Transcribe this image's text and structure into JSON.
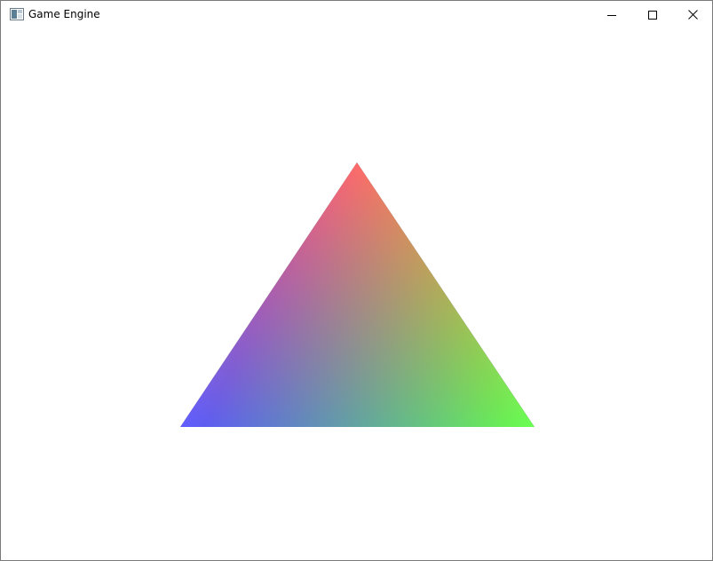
{
  "window": {
    "title": "Game Engine",
    "buttons": {
      "minimize_icon": "minimize-icon",
      "maximize_icon": "maximize-icon",
      "close_icon": "close-icon"
    }
  },
  "scene": {
    "shape": "triangle",
    "vertex_colors": {
      "top": "#ff1a1a",
      "bottom_left": "#1a1aff",
      "bottom_right": "#2aff0a"
    },
    "background": "#ffffff"
  }
}
